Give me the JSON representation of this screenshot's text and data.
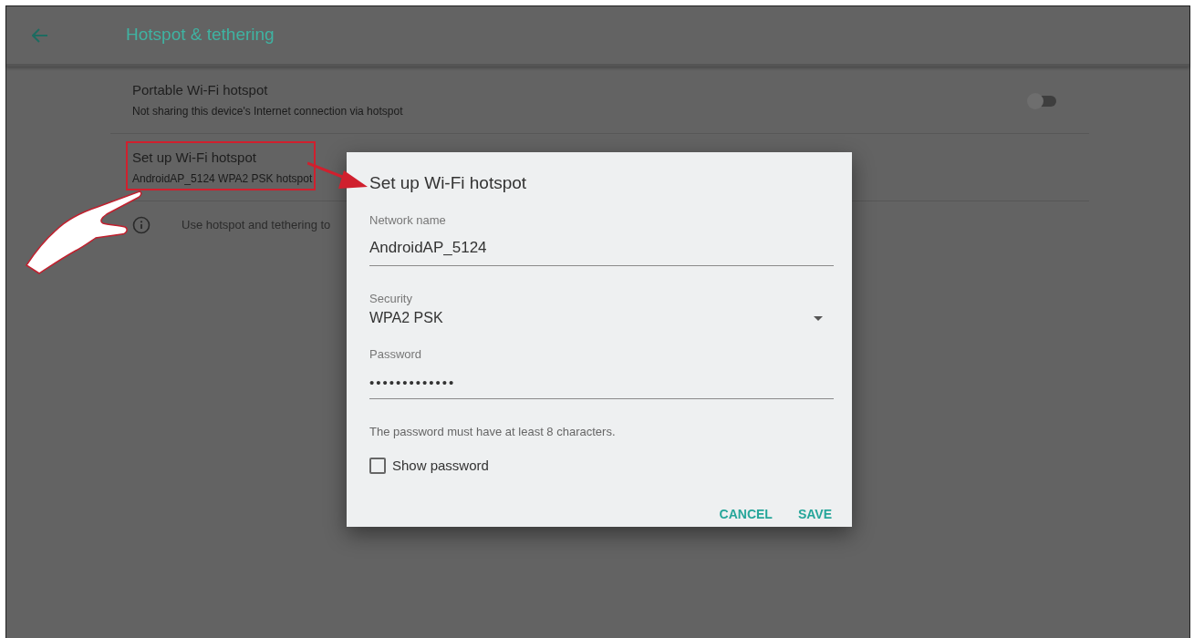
{
  "header": {
    "title": "Hotspot & tethering"
  },
  "settings": [
    {
      "kind": "toggle",
      "title": "Portable Wi-Fi hotspot",
      "subtitle": "Not sharing this device's Internet connection via hotspot",
      "on": false,
      "highlighted": false
    },
    {
      "kind": "plain",
      "title": "Set up Wi-Fi hotspot",
      "subtitle": "AndroidAP_5124 WPA2 PSK hotspot",
      "highlighted": true
    }
  ],
  "info": {
    "text": "Use hotspot and tethering to"
  },
  "dialog": {
    "title": "Set up Wi-Fi hotspot",
    "network_name": {
      "label": "Network name",
      "value": "AndroidAP_5124"
    },
    "security": {
      "label": "Security",
      "value": "WPA2 PSK"
    },
    "password": {
      "label": "Password",
      "value": "•••••••••••••"
    },
    "hint": "The password must have at least 8 characters.",
    "show_password": {
      "label": "Show password",
      "checked": false
    },
    "buttons": [
      "CANCEL",
      "SAVE"
    ]
  }
}
